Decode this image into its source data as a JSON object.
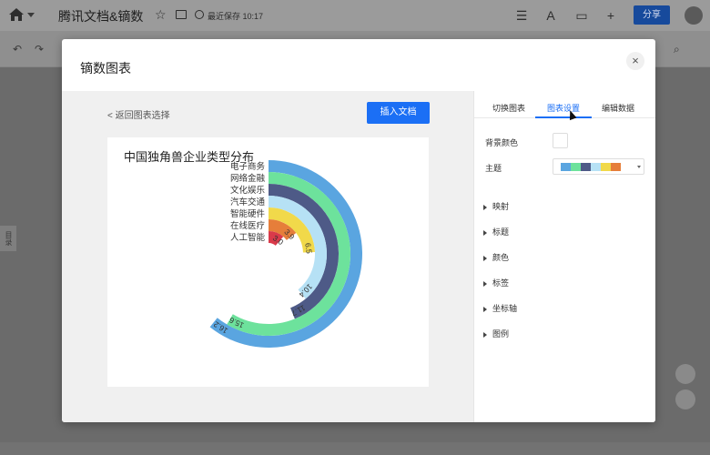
{
  "app": {
    "doc_title": "腾讯文档&镝数",
    "saved_status": "最近保存 10:17",
    "share_label": "分享",
    "side_tab": "目录"
  },
  "modal": {
    "title": "镝数图表",
    "close_icon": "close-icon",
    "back_label": "返回图表选择",
    "insert_label": "插入文档"
  },
  "panel": {
    "tabs": [
      {
        "label": "切换图表",
        "active": false
      },
      {
        "label": "图表设置",
        "active": true
      },
      {
        "label": "编辑数据",
        "active": false
      }
    ],
    "background_color_label": "背景颜色",
    "background_color": "#ffffff",
    "theme_label": "主题",
    "theme_colors": [
      "#5aa5e0",
      "#6de29c",
      "#4e5a87",
      "#b6e1f5",
      "#f1d94a",
      "#e67e3a"
    ],
    "sections": [
      "映射",
      "标题",
      "颜色",
      "标签",
      "坐标轴",
      "图例"
    ]
  },
  "chart_data": {
    "type": "radial-bar",
    "title": "中国独角兽企业类型分布",
    "categories": [
      "电子商务",
      "网络金融",
      "文化娱乐",
      "汽车交通",
      "智能硬件",
      "在线医疗",
      "人工智能"
    ],
    "values": [
      16.2,
      15.6,
      11.7,
      10.4,
      6.5,
      3.9,
      3.0
    ],
    "value_labels": [
      "16.2",
      "15.6",
      "11.7",
      "10.4",
      "6.5",
      "3.9",
      "3.0"
    ],
    "max": 20,
    "colors": [
      "#5aa5e0",
      "#6de29c",
      "#4e5a87",
      "#b6e1f5",
      "#f1d94a",
      "#e67e3a",
      "#d93a4a"
    ]
  }
}
